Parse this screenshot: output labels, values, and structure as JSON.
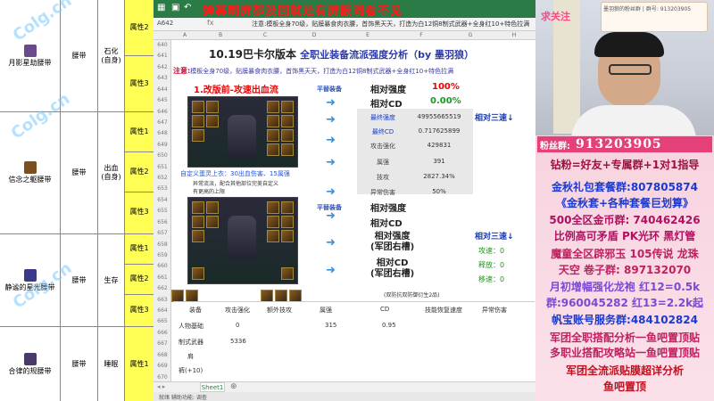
{
  "left_table": {
    "rows": [
      {
        "name": "月影星劫腰带",
        "slot": "腰带",
        "skill": "石化\n(自身)",
        "attrs": [
          "属性2",
          "属性3"
        ],
        "icon_color": "#6a4a8a"
      },
      {
        "name": "信念之躯腰带",
        "slot": "腰带",
        "skill": "出血\n(自身)",
        "attrs": [
          "属性1",
          "属性2",
          "属性3"
        ],
        "icon_color": "#7a5020"
      },
      {
        "name": "静谧的星光腰带",
        "slot": "腰带",
        "skill": "生存",
        "attrs": [
          "属性1",
          "属性2",
          "属性3"
        ],
        "icon_color": "#3a3a8a"
      },
      {
        "name": "合律的规腰带",
        "slot": "腰带",
        "skill": "睡眠",
        "attrs": [
          "属性1"
        ],
        "icon_color": "#4a3a6a"
      }
    ],
    "watermark": "Colg.cn"
  },
  "spreadsheet": {
    "danmu": "弹幕刷屏都没回就是有屏蔽词看不见",
    "cell_ref": "A642",
    "formula": "注意:模板全身70级，贴膜暴食肉衣腰，首饰黑天天，打造为白12铜8制式武器+全身红10+特色拉满",
    "columns": [
      "A",
      "B",
      "C",
      "D",
      "E",
      "F",
      "G",
      "H"
    ],
    "row_numbers": [
      "640",
      "641",
      "642",
      "643",
      "644",
      "645",
      "646",
      "647",
      "648",
      "649",
      "650",
      "651",
      "652",
      "653",
      "654",
      "655",
      "656",
      "657",
      "658",
      "659",
      "660",
      "661",
      "662",
      "663",
      "664",
      "665",
      "666",
      "667",
      "668",
      "669",
      "670"
    ],
    "title_main": "10.19巴卡尔版本",
    "title_sub": "全职业装备流派强度分析（by 墨羽狼）",
    "note_prefix": "注意:",
    "note_text": "模板全身70级，贴膜暴食肉衣腰，首饰黑天天，打造为白12铜8制式武器+全身红10+特色拉满",
    "section1_title": "1.改版前-攻速出血流",
    "equip_label_1": "平替装备",
    "equip_label_2": "平替装备",
    "stat1_label": "相对强度",
    "stat1_value": "100%",
    "stat2_label": "相对CD",
    "stat2_value": "0.00%",
    "kv_rows": [
      {
        "k": "最终强度",
        "v": "49955665519"
      },
      {
        "k": "最终CD",
        "v": "0.717625899"
      },
      {
        "k": "攻击强化",
        "v": "429831"
      },
      {
        "k": "属强",
        "v": "391"
      },
      {
        "k": "技攻",
        "v": "2827.34%"
      },
      {
        "k": "异常伤害",
        "v": "50%"
      }
    ],
    "relative_speed_1": "相对三速↓",
    "custom_set_line": "自定义蛋灵上衣：30出血伤害、15属强",
    "abnormal_line": "异常流派，配合其他部位完美自定义",
    "upper_limit_line": "有更高的上限",
    "second_stat1_label": "相对强度",
    "second_stat2_label": "相对CD",
    "second_stat3_label": "相对强度\n(军团右槽)",
    "second_stat4_label": "相对CD\n(军团右槽)",
    "relative_speed_2": "相对三速↓",
    "speed_rows": [
      {
        "k": "攻速：",
        "v": "0"
      },
      {
        "k": "释放：",
        "v": "0"
      },
      {
        "k": "移速：",
        "v": "0"
      }
    ],
    "footnote": "(双防抗双防御衍生2品)",
    "table_headers": [
      "装备",
      "攻击强化",
      "额外技攻",
      "属强",
      "CD",
      "技能恢复速度",
      "异常伤害"
    ],
    "table_rows": [
      {
        "label": "人物基础",
        "atk": "0",
        "elem": "315",
        "cd": "0.95"
      },
      {
        "label": "制式武器",
        "atk": "5336"
      },
      {
        "label": "肩"
      },
      {
        "label": "裤(+10)"
      }
    ],
    "sheet_tab": "Sheet1",
    "status_text": "就绪  辅助功能: 调查"
  },
  "stream": {
    "qiu": "求关注",
    "qq_card_text": "墨羽狼的粉丝群 | 群号: 913203905",
    "fan_label": "粉丝群:",
    "fan_number": "913203905",
    "lines": [
      {
        "text": "钻粉=好友+专属群+1对1指导",
        "color": "#a01040"
      },
      {
        "text": "金秋礼包套餐群:807805874",
        "color": "#1a3ad0"
      },
      {
        "text": "《金秋套+各种套餐巨划算》",
        "color": "#1a3ad0"
      },
      {
        "text": "500全区金币群: 740462426",
        "color": "#b01060"
      },
      {
        "text": "比例高可矛盾 PK光环 黑灯管",
        "color": "#b01060"
      },
      {
        "text": "魔童全区辟邪玉 105传说 龙珠",
        "color": "#c02060"
      },
      {
        "text": "天空 卷子群: 897132070",
        "color": "#c02060"
      },
      {
        "text": "月初增幅强化龙袍 红12=0.5k",
        "color": "#7a4ad0"
      },
      {
        "text": "群:960045282  红13=2.2k起",
        "color": "#7a4ad0"
      },
      {
        "text": "帆宝账号服务群:484102824",
        "color": "#1a3ad0"
      },
      {
        "text": "军团全职搭配分析一鱼吧置顶贴",
        "color": "#c02060"
      },
      {
        "text": "多职业搭配攻略站一鱼吧置顶贴",
        "color": "#c02060"
      },
      {
        "text": "军团全流派贴膜超详分析",
        "color": "#c01020"
      },
      {
        "text": "鱼吧置顶",
        "color": "#c01020"
      }
    ]
  }
}
